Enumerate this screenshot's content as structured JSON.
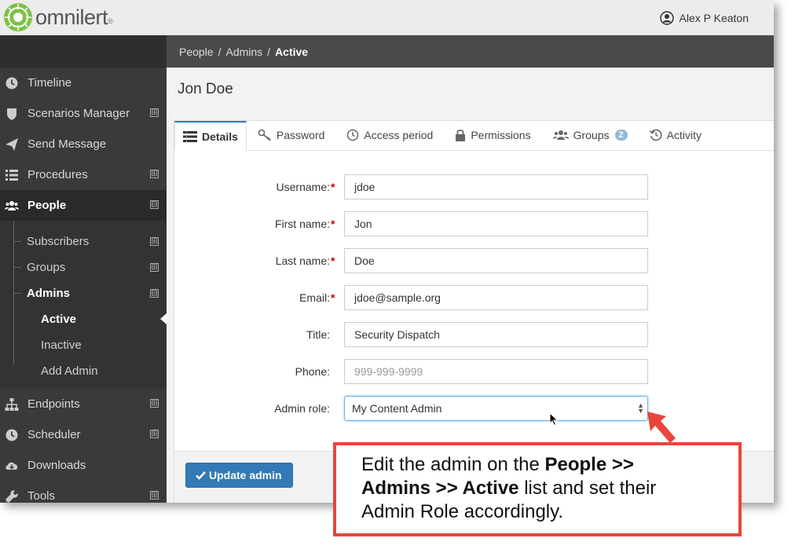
{
  "app": {
    "logo_text": "omnilert",
    "logo_mark": "®",
    "user_name": "Alex P Keaton"
  },
  "breadcrumb": [
    "People",
    "Admins",
    "Active"
  ],
  "breadcrumb_sep": "/",
  "page_title": "Jon Doe",
  "sidebar": {
    "items": [
      {
        "label": "Timeline",
        "icon": "clock-icon",
        "expandable": false
      },
      {
        "label": "Scenarios Manager",
        "icon": "shield-icon",
        "expandable": true
      },
      {
        "label": "Send Message",
        "icon": "paper-plane-icon",
        "expandable": false
      },
      {
        "label": "Procedures",
        "icon": "list-icon",
        "expandable": true
      },
      {
        "label": "People",
        "icon": "users-icon",
        "expandable": true,
        "expanded": true
      }
    ],
    "people_sub": [
      {
        "label": "Subscribers",
        "expandable": true
      },
      {
        "label": "Groups",
        "expandable": true
      },
      {
        "label": "Admins",
        "expandable": true,
        "expanded": true
      }
    ],
    "admins_sub": [
      "Active",
      "Inactive",
      "Add Admin"
    ],
    "items_after": [
      {
        "label": "Endpoints",
        "icon": "sitemap-icon",
        "expandable": true
      },
      {
        "label": "Scheduler",
        "icon": "clock-icon",
        "expandable": true
      },
      {
        "label": "Downloads",
        "icon": "cloud-download-icon",
        "expandable": false
      },
      {
        "label": "Tools",
        "icon": "wrench-icon",
        "expandable": true
      }
    ],
    "expand_glyph": "⊞",
    "collapse_glyph": "⊟"
  },
  "tabs": [
    {
      "label": "Details",
      "icon": "list-alt-icon",
      "active": true
    },
    {
      "label": "Password",
      "icon": "key-icon"
    },
    {
      "label": "Access period",
      "icon": "clock-icon"
    },
    {
      "label": "Permissions",
      "icon": "lock-icon"
    },
    {
      "label": "Groups",
      "icon": "users-icon",
      "badge": "2"
    },
    {
      "label": "Activity",
      "icon": "history-icon"
    }
  ],
  "form": {
    "username": {
      "label": "Username:",
      "value": "jdoe",
      "required": true
    },
    "first_name": {
      "label": "First name:",
      "value": "Jon",
      "required": true
    },
    "last_name": {
      "label": "Last name:",
      "value": "Doe",
      "required": true
    },
    "email": {
      "label": "Email:",
      "value": "jdoe@sample.org",
      "required": true
    },
    "title": {
      "label": "Title:",
      "value": "Security Dispatch",
      "required": false
    },
    "phone": {
      "label": "Phone:",
      "value": "",
      "placeholder": "999-999-9999",
      "required": false
    },
    "admin_role": {
      "label": "Admin role:",
      "value": "My Content Admin"
    },
    "required_mark": "*"
  },
  "update_button": "Update admin",
  "callout": {
    "t1": "Edit the admin on the ",
    "b1": "People >>",
    "b2": "Admins >> Active",
    "t2": " list and set their",
    "t3": "Admin Role accordingly."
  },
  "colors": {
    "primary": "#337ab7",
    "sidebar": "#3a3a3a",
    "callout_border": "#e8453c",
    "logo_green": "#7cc242"
  }
}
